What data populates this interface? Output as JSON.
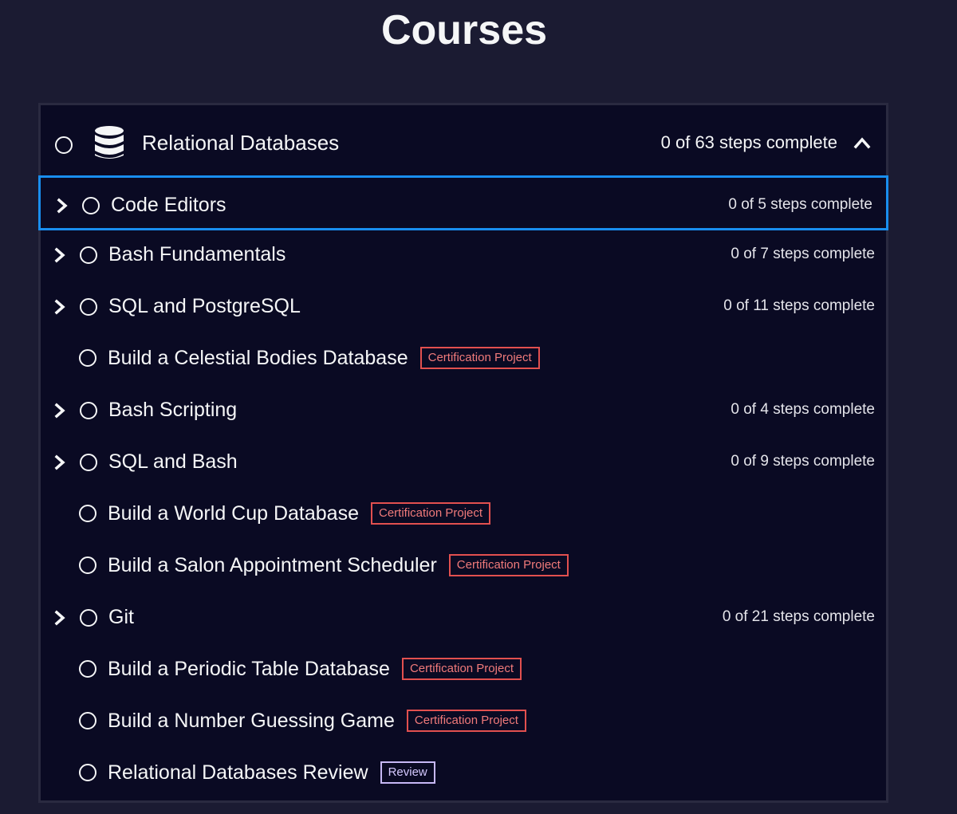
{
  "page": {
    "title": "Courses"
  },
  "superblock": {
    "title": "Relational Databases",
    "progress": "0 of 63 steps complete",
    "icon": "database-icon",
    "expand_icon": "chevron-up-icon"
  },
  "colors": {
    "background": "#1b1b32",
    "panel": "#0a0a23",
    "selected_border": "#198eee",
    "cert_badge": "#e2504f",
    "review_badge": "#c7b8f5"
  },
  "blocks": [
    {
      "title": "Code Editors",
      "progress": "0 of 5 steps complete",
      "expandable": true,
      "selected": true
    },
    {
      "title": "Bash Fundamentals",
      "progress": "0 of 7 steps complete",
      "expandable": true
    },
    {
      "title": "SQL and PostgreSQL",
      "progress": "0 of 11 steps complete",
      "expandable": true
    },
    {
      "title": "Build a Celestial Bodies Database",
      "badge": "Certification Project"
    },
    {
      "title": "Bash Scripting",
      "progress": "0 of 4 steps complete",
      "expandable": true
    },
    {
      "title": "SQL and Bash",
      "progress": "0 of 9 steps complete",
      "expandable": true
    },
    {
      "title": "Build a World Cup Database",
      "badge": "Certification Project"
    },
    {
      "title": "Build a Salon Appointment Scheduler",
      "badge": "Certification Project"
    },
    {
      "title": "Git",
      "progress": "0 of 21 steps complete",
      "expandable": true
    },
    {
      "title": "Build a Periodic Table Database",
      "badge": "Certification Project"
    },
    {
      "title": "Build a Number Guessing Game",
      "badge": "Certification Project"
    },
    {
      "title": "Relational Databases Review",
      "badge": "Review"
    }
  ]
}
